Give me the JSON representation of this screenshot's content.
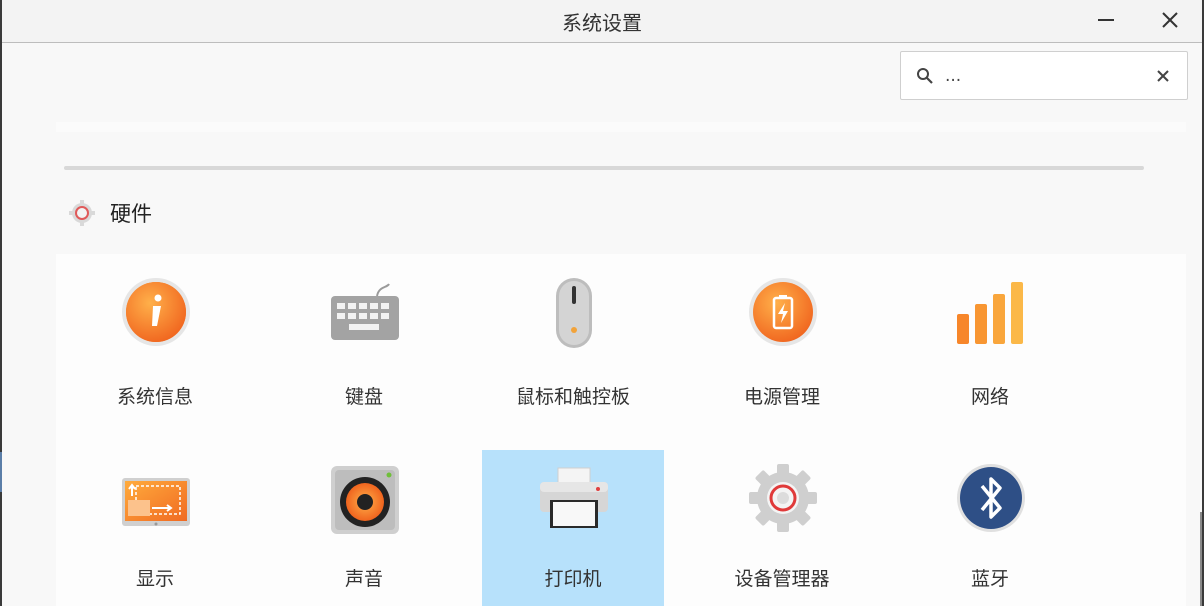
{
  "window": {
    "title": "系统设置"
  },
  "search": {
    "placeholder": "...",
    "value": ""
  },
  "section": {
    "title": "硬件"
  },
  "tiles": [
    {
      "label": "系统信息",
      "icon": "info-icon"
    },
    {
      "label": "键盘",
      "icon": "keyboard-icon"
    },
    {
      "label": "鼠标和触控板",
      "icon": "mouse-icon"
    },
    {
      "label": "电源管理",
      "icon": "battery-icon"
    },
    {
      "label": "网络",
      "icon": "network-signal-icon"
    },
    {
      "label": "显示",
      "icon": "display-icon"
    },
    {
      "label": "声音",
      "icon": "speaker-icon"
    },
    {
      "label": "打印机",
      "icon": "printer-icon",
      "selected": true
    },
    {
      "label": "设备管理器",
      "icon": "gear-icon"
    },
    {
      "label": "蓝牙",
      "icon": "bluetooth-icon"
    }
  ],
  "colors": {
    "accent_orange": "#f7862a",
    "selected_bg": "#b7e1fb",
    "bluetooth_blue": "#2e4f86"
  }
}
